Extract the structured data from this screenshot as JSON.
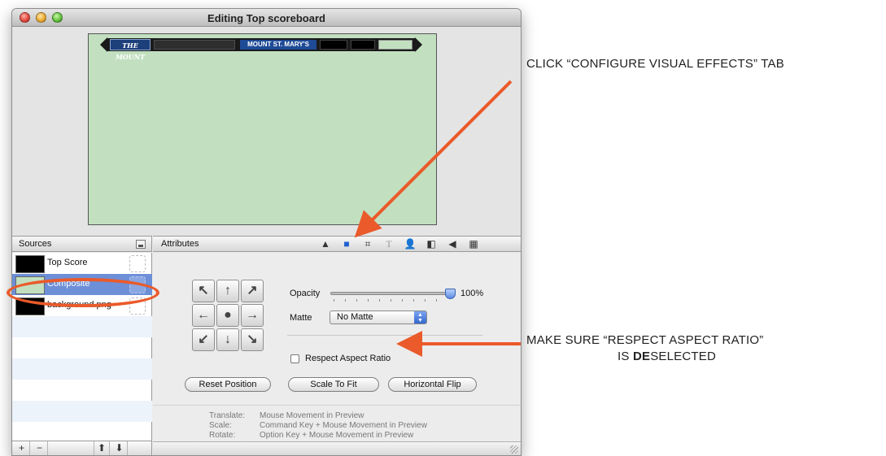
{
  "window": {
    "title": "Editing Top scoreboard"
  },
  "scoreboard": {
    "logo_text": "THE MOUNT",
    "team_name": "MOUNT ST. MARY'S"
  },
  "sources_panel": {
    "header": "Sources",
    "items": [
      {
        "label": "Top Score"
      },
      {
        "label": "Composite",
        "selected": true
      },
      {
        "label": "background.png"
      }
    ],
    "footer": {
      "add": "+",
      "remove": "−",
      "move_up": "⬆",
      "move_down": "⬇"
    }
  },
  "attributes_panel": {
    "header": "Attributes",
    "tabs": [
      "shapes-icon",
      "folder-icon",
      "crop-icon",
      "text-icon",
      "person-icon",
      "split-icon",
      "speaker-icon",
      "checker-icon"
    ],
    "tab_glyphs": [
      "▲",
      "■",
      "⌗",
      "T",
      "👤",
      "◧",
      "◀",
      "▦"
    ],
    "opacity": {
      "label": "Opacity",
      "value": "100%",
      "fraction": 1.0
    },
    "matte": {
      "label": "Matte",
      "value": "No Matte"
    },
    "respect_aspect_ratio": {
      "label": "Respect Aspect Ratio",
      "checked": false
    },
    "buttons": {
      "reset_position": "Reset Position",
      "scale_to_fit": "Scale To Fit",
      "horizontal_flip": "Horizontal Flip"
    },
    "hints": [
      {
        "key": "Translate:",
        "value": "Mouse Movement in Preview"
      },
      {
        "key": "Scale:",
        "value": "Command Key + Mouse Movement in Preview"
      },
      {
        "key": "Rotate:",
        "value": "Option Key + Mouse Movement in Preview"
      }
    ]
  },
  "annotations": {
    "tab_callout": "CLICK “CONFIGURE VISUAL EFFECTS” TAB",
    "aspect_callout_line1": "MAKE SURE “RESPECT ASPECT RATIO”",
    "aspect_callout_line2_pre": "IS ",
    "aspect_callout_line2_bold": "DE",
    "aspect_callout_line2_post": "SELECTED",
    "accent_color": "#ea5a2a"
  }
}
